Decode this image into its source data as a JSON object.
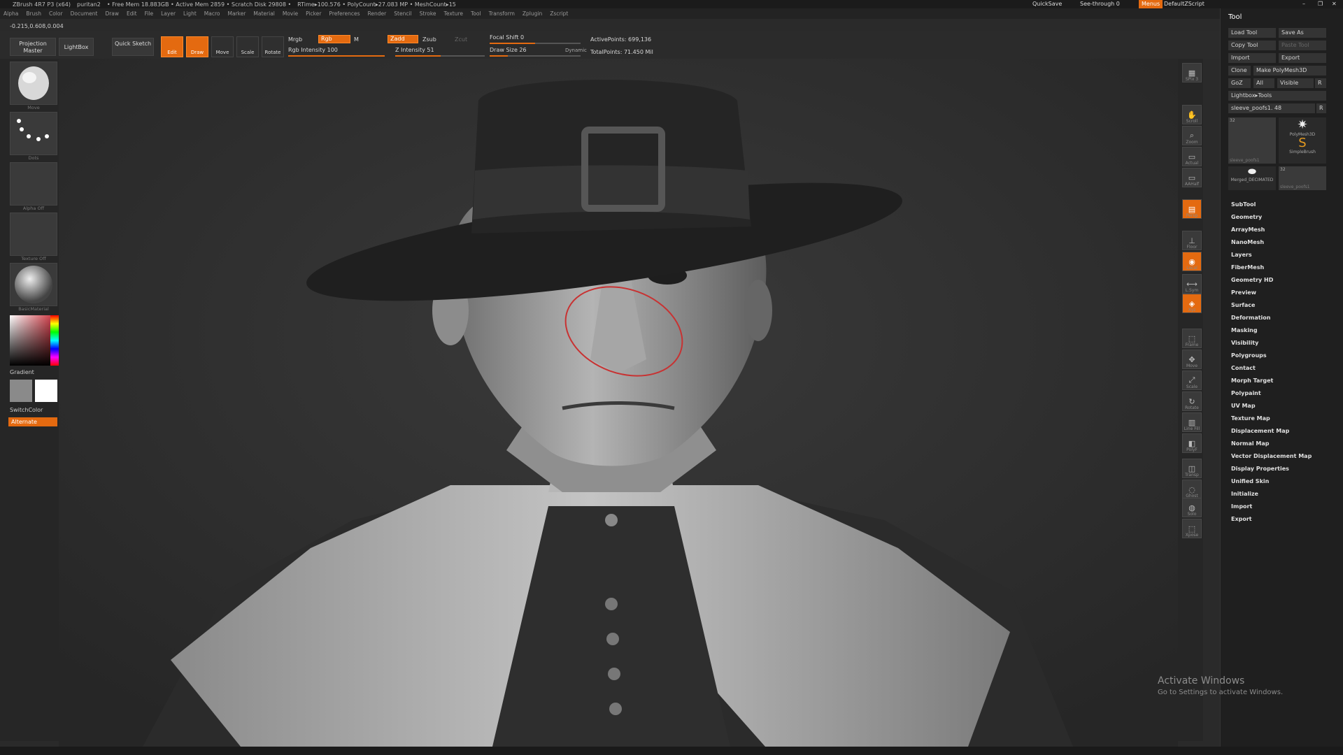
{
  "titlebar": {
    "app": "ZBrush 4R7 P3 (x64)",
    "doc": "puritan2",
    "freemem": "• Free Mem 18.883GB • Active Mem 2859 • Scratch Disk 29808 •",
    "rtime": "RTime▸100.576 • PolyCount▸27.083 MP • MeshCount▸15",
    "quicksave": "QuickSave",
    "seethrough": "See-through  0",
    "menus": "Menus",
    "script": "DefaultZScript"
  },
  "menubar": [
    "Alpha",
    "Brush",
    "Color",
    "Document",
    "Draw",
    "Edit",
    "File",
    "Layer",
    "Light",
    "Macro",
    "Marker",
    "Material",
    "Movie",
    "Picker",
    "Preferences",
    "Render",
    "Stencil",
    "Stroke",
    "Texture",
    "Tool",
    "Transform",
    "Zplugin",
    "Zscript"
  ],
  "coords": "-0.215,0.608,0.004",
  "toolbar": {
    "projection_master": "Projection Master",
    "lightbox": "LightBox",
    "quick_sketch": "Quick Sketch",
    "edit": "Edit",
    "draw": "Draw",
    "move": "Move",
    "scale": "Scale",
    "rotate": "Rotate",
    "mrgb": "Mrgb",
    "rgb": "Rgb",
    "m": "M",
    "zadd": "Zadd",
    "zsub": "Zsub",
    "zcut": "Zcut",
    "rgb_intensity": "Rgb Intensity 100",
    "z_intensity": "Z Intensity 51",
    "focal_shift": "Focal Shift 0",
    "draw_size": "Draw Size 26",
    "dynamic": "Dynamic",
    "active_points": "ActivePoints: 699,136",
    "total_points": "TotalPoints: 71.450 Mil"
  },
  "left_shelf": {
    "brush_label": "Move",
    "stroke_label": "Dots",
    "alpha_label": "Alpha Off",
    "texture_label": "Texture Off",
    "material_label": "BasicMaterial",
    "gradient": "Gradient",
    "switchcolor": "SwitchColor",
    "alternate": "Alternate"
  },
  "right_shelf": {
    "items": [
      "SPix 3",
      "Scroll",
      "Zoom",
      "Actual",
      "AAHalf",
      "Persp",
      "Floor",
      "Local",
      "L.Sym",
      "Xyz",
      "Frame",
      "Move",
      "Scale",
      "Rotate",
      "Line Fill",
      "PolyF",
      "Transp",
      "Ghost",
      "Solo",
      "Xpose"
    ]
  },
  "tool_panel": {
    "title": "Tool",
    "load_tool": "Load Tool",
    "save_as": "Save As",
    "copy_tool": "Copy Tool",
    "paste_tool": "Paste Tool",
    "import": "Import",
    "export": "Export",
    "clone": "Clone",
    "make_polymesh": "Make PolyMesh3D",
    "goz": "GoZ",
    "all": "All",
    "visible": "Visible",
    "r": "R",
    "lightbox_tools": "Lightbox▸Tools",
    "current_tool": "sleeve_poofs1. 48",
    "thumb_labels": [
      "sleeve_poofs1",
      "PolyMesh3D",
      "SimpleBrush",
      "Merged_DECIMATED",
      "sleeve_poofs1"
    ],
    "thumb_counts": [
      "32",
      "32"
    ],
    "sections": [
      "SubTool",
      "Geometry",
      "ArrayMesh",
      "NanoMesh",
      "Layers",
      "FiberMesh",
      "Geometry HD",
      "Preview",
      "Surface",
      "Deformation",
      "Masking",
      "Visibility",
      "Polygroups",
      "Contact",
      "Morph Target",
      "Polypaint",
      "UV Map",
      "Texture Map",
      "Displacement Map",
      "Normal Map",
      "Vector Displacement Map",
      "Display Properties",
      "Unified Skin",
      "Initialize",
      "Import",
      "Export"
    ]
  },
  "watermark": {
    "line1": "Activate Windows",
    "line2": "Go to Settings to activate Windows."
  },
  "colors": {
    "accent": "#e46a10",
    "panel": "#1f1f1f",
    "viewport": "#2c2c2c"
  }
}
